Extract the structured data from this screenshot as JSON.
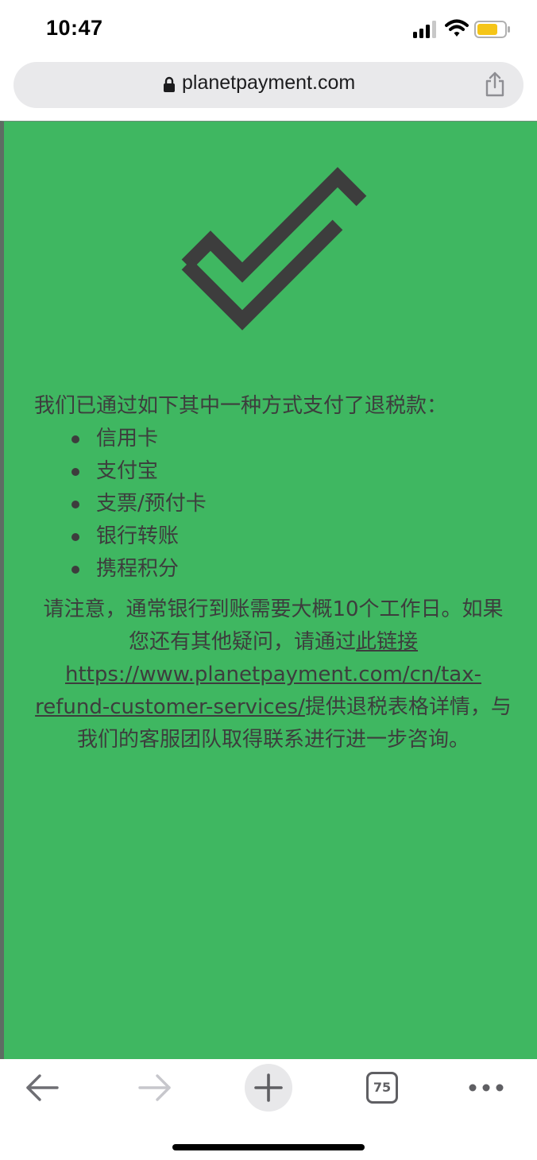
{
  "status_bar": {
    "time": "10:47",
    "icons": [
      "signal-icon",
      "wifi-icon",
      "battery-icon"
    ],
    "battery_color": "#f5c518"
  },
  "browser": {
    "url": "planetpayment.com",
    "icons": [
      "lock-icon",
      "share-icon"
    ]
  },
  "page": {
    "background_color": "#3fb761",
    "text_color": "#3d3d3d",
    "icon": "checkmark-icon",
    "intro": "我们已通过如下其中一种方式支付了退税款：",
    "methods": [
      {
        "label": "信用卡"
      },
      {
        "label": "支付宝"
      },
      {
        "label": "支票/预付卡"
      },
      {
        "label": "银行转账"
      },
      {
        "label": "携程积分"
      }
    ],
    "note_part1": "请注意，通常银行到账需要大概10个工作日。如果您还有其他疑问，请通过",
    "link_label": "此链接 https://www.planetpayment.com/cn/tax-refund-customer-services/",
    "note_part2": "提供退税表格详情，与我们的客服团队取得联系进行进一步咨询。"
  },
  "toolbar": {
    "icons": [
      "back-arrow-icon",
      "forward-arrow-icon",
      "plus-icon",
      "tabs-icon",
      "more-dots-icon"
    ],
    "tab_count": "75"
  }
}
